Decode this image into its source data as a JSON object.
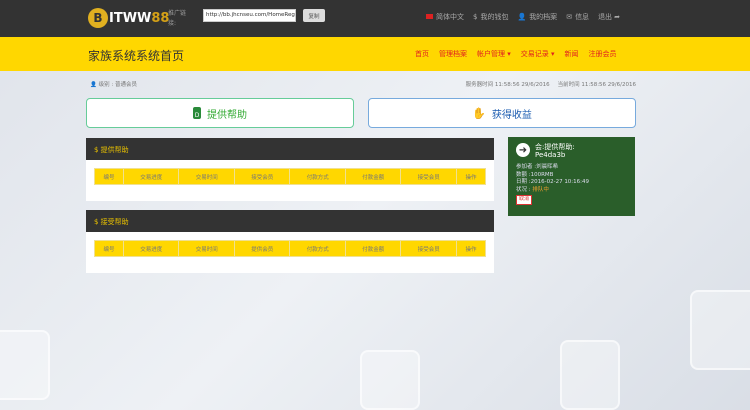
{
  "header": {
    "logo_prefix": "B",
    "logo_main": "ITWW",
    "logo_num": "88",
    "ref_label": "推广链接:",
    "ref_url": "http://bb.jhcnseu.com/HomeReg",
    "copy": "复制",
    "nav": [
      {
        "icon": "flag-cn-icon",
        "label": "简体中文"
      },
      {
        "icon": "$",
        "label": "我的钱包"
      },
      {
        "icon": "👤",
        "label": "我的档案"
      },
      {
        "icon": "✉",
        "label": "信息"
      },
      {
        "icon": "➦",
        "label": "退出"
      }
    ]
  },
  "ybar": {
    "title": "家族系统系统首页",
    "menu": [
      "首页",
      "管理档案",
      "帐户管理 ▾",
      "交易记录 ▾",
      "新闻",
      "注册会员"
    ]
  },
  "crumb": "级别 : 普通会员",
  "times": {
    "server_label": "服务器时间",
    "server": "11:58:56 29/6/2016",
    "current_label": "当前时间",
    "current": "11:58:56 29/6/2016"
  },
  "buttons": {
    "provide": "提供帮助",
    "receive": "获得收益"
  },
  "panels": [
    {
      "title": "$ 提供帮助",
      "cols": [
        "编号",
        "交易进度",
        "交易时间",
        "接受会员",
        "付款方式",
        "付款金额",
        "接受会员",
        "操作"
      ]
    },
    {
      "title": "$ 接受帮助",
      "cols": [
        "编号",
        "交易进度",
        "交易时间",
        "提供会员",
        "付款方式",
        "付款金额",
        "接受会员",
        "操作"
      ]
    }
  ],
  "card": {
    "title": "会:提供帮助:",
    "id": "Pe4da3b",
    "participant": "参加者 :刘晨晖希",
    "amount": "数额 :100RMB",
    "date": "日期 :2016-02-27 10:16:49",
    "status_label": "状况 :",
    "status": "排队中",
    "cancel": "取消"
  }
}
